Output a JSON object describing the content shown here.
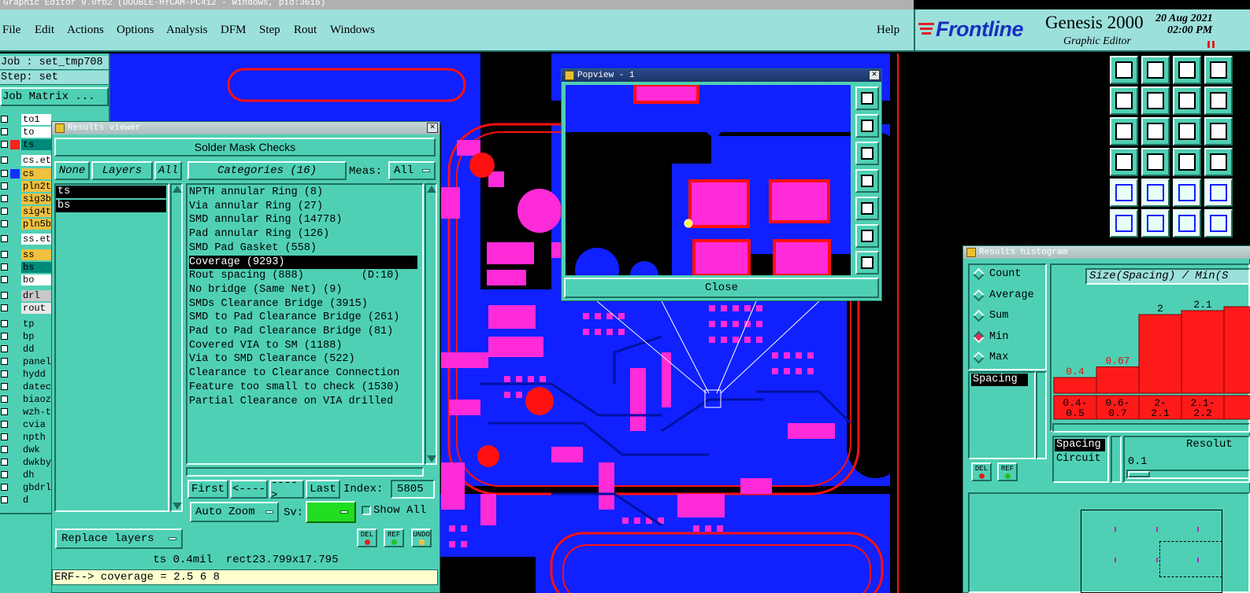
{
  "window": {
    "title": "Graphic Editor 9.0fb2 (DOUBLE-HYCAM-PC412 - Windows, pid:3616)"
  },
  "menu": {
    "items": [
      "File",
      "Edit",
      "Actions",
      "Options",
      "Analysis",
      "DFM",
      "Step",
      "Rout",
      "Windows"
    ],
    "help": "Help"
  },
  "brand": {
    "logo": "Frontline",
    "product": "Genesis 2000",
    "subtitle": "Graphic Editor",
    "date": "20 Aug 2021",
    "time": "02:00 PM"
  },
  "left_panel": {
    "job": "Job : set_tmp708",
    "step": "Step: set",
    "job_matrix": "Job Matrix ...",
    "layers": [
      {
        "name": "to1",
        "swatch": "",
        "bg": "#ffffff"
      },
      {
        "name": "to",
        "swatch": "",
        "bg": "#ffffff"
      },
      {
        "name": "ts",
        "swatch": "#ff2020",
        "bg": "#008878"
      },
      {
        "name": "cs.et",
        "swatch": "",
        "bg": "#ffffff"
      },
      {
        "name": "cs",
        "swatch": "#1030ff",
        "bg": "#f0c040"
      },
      {
        "name": "pln2t",
        "swatch": "",
        "bg": "#f0c040"
      },
      {
        "name": "sig3b",
        "swatch": "",
        "bg": "#f0c040"
      },
      {
        "name": "sig4t",
        "swatch": "",
        "bg": "#f0c040"
      },
      {
        "name": "pln5b",
        "swatch": "",
        "bg": "#f0c040"
      },
      {
        "name": "ss.et",
        "swatch": "",
        "bg": "#ffffff"
      },
      {
        "name": "ss",
        "swatch": "",
        "bg": "#f0c040"
      },
      {
        "name": "bs",
        "swatch": "",
        "bg": "#008878"
      },
      {
        "name": "bo",
        "swatch": "",
        "bg": "#ffffff"
      },
      {
        "name": "drl",
        "swatch": "",
        "bg": "#c8c8c8"
      },
      {
        "name": "rout",
        "swatch": "",
        "bg": "#e8e8e8"
      },
      {
        "name": "tp",
        "swatch": "",
        "bg": "#4fd0b4"
      },
      {
        "name": "bp",
        "swatch": "",
        "bg": "#4fd0b4"
      },
      {
        "name": "dd",
        "swatch": "",
        "bg": "#4fd0b4"
      },
      {
        "name": "panel",
        "swatch": "",
        "bg": "#4fd0b4"
      },
      {
        "name": "hydd",
        "swatch": "",
        "bg": "#4fd0b4"
      },
      {
        "name": "datec",
        "swatch": "",
        "bg": "#4fd0b4"
      },
      {
        "name": "biaoz",
        "swatch": "",
        "bg": "#4fd0b4"
      },
      {
        "name": "wzh-t",
        "swatch": "",
        "bg": "#4fd0b4"
      },
      {
        "name": "cvia",
        "swatch": "",
        "bg": "#4fd0b4"
      },
      {
        "name": "npth",
        "swatch": "",
        "bg": "#4fd0b4"
      },
      {
        "name": "dwk",
        "swatch": "",
        "bg": "#4fd0b4"
      },
      {
        "name": "dwkby",
        "swatch": "",
        "bg": "#4fd0b4"
      },
      {
        "name": "dh",
        "swatch": "",
        "bg": "#4fd0b4"
      },
      {
        "name": "gbdrl",
        "swatch": "",
        "bg": "#4fd0b4"
      },
      {
        "name": "d",
        "swatch": "",
        "bg": "#4fd0b4"
      }
    ]
  },
  "results_viewer": {
    "title": "Results viewer",
    "header": "Solder Mask Checks",
    "none_btn": "None",
    "layers_btn": "Layers",
    "all_btn": "All",
    "categories_btn": "Categories (16)",
    "meas_label": "Meas:",
    "meas_value": "All",
    "layers": [
      "ts",
      "bs"
    ],
    "categories": [
      "NPTH annular Ring (8)",
      "Via annular Ring (27)",
      "SMD annular Ring (14778)",
      "Pad annular Ring (126)",
      "SMD Pad Gasket (558)",
      "Coverage (9293)",
      "Rout spacing (888)         (D:10)",
      "No bridge (Same Net) (9)",
      "SMDs Clearance Bridge (3915)",
      "SMD to Pad Clearance Bridge (261)",
      "Pad to Pad Clearance Bridge (81)",
      "Covered VIA to SM (1188)",
      "Via to SMD Clearance (522)",
      "Clearance to Clearance Connection",
      "Feature too small to check (1530)",
      "Partial Clearance on VIA drilled"
    ],
    "selected_category_index": 5,
    "first": "First",
    "prev": "<----",
    "next": "---->",
    "last": "Last",
    "index_label": "Index:",
    "index_value": "5805",
    "auto_zoom": "Auto Zoom",
    "sv_label": "Sv:",
    "show_all": "Show All",
    "replace_layers": "Replace layers",
    "del": "DEL",
    "ref": "REF",
    "undo": "UNDO",
    "status": "ts 0.4mil  rect23.799x17.795",
    "erf": "ERF--> coverage = 2.5 6 8"
  },
  "popview": {
    "title": "Popview - 1",
    "close": "Close"
  },
  "histogram": {
    "title": "Results histogram",
    "modes": [
      "Count",
      "Average",
      "Sum",
      "Min",
      "Max"
    ],
    "selected_mode": "Min",
    "header": "Size(Spacing) / Min(S",
    "measure_list": [
      "Spacing"
    ],
    "type_list": [
      "Spacing",
      "Circuit"
    ],
    "resolution_label": "Resolut",
    "resolution_value": "0.1",
    "del": "DEL",
    "ref": "REF"
  },
  "chart_data": {
    "type": "bar",
    "categories": [
      "0.4-\n0.5",
      "0.6-\n0.7",
      "2-\n2.1",
      "2.1-\n2.2",
      ""
    ],
    "values": [
      0.4,
      0.67,
      2,
      2.1,
      2.2
    ],
    "labels": [
      "0.4",
      "0.67",
      "2",
      "2.1",
      ""
    ],
    "ylim": [
      0,
      2.6
    ],
    "title": "",
    "xlabel": "",
    "ylabel": ""
  },
  "colors": {
    "panel": "#4fd0b4",
    "menubar": "#9ce0dc",
    "board_blue": "#1020ff",
    "board_magenta": "#ff2ad8",
    "board_red": "#ff1010",
    "bar_red": "#ff1a1a"
  }
}
